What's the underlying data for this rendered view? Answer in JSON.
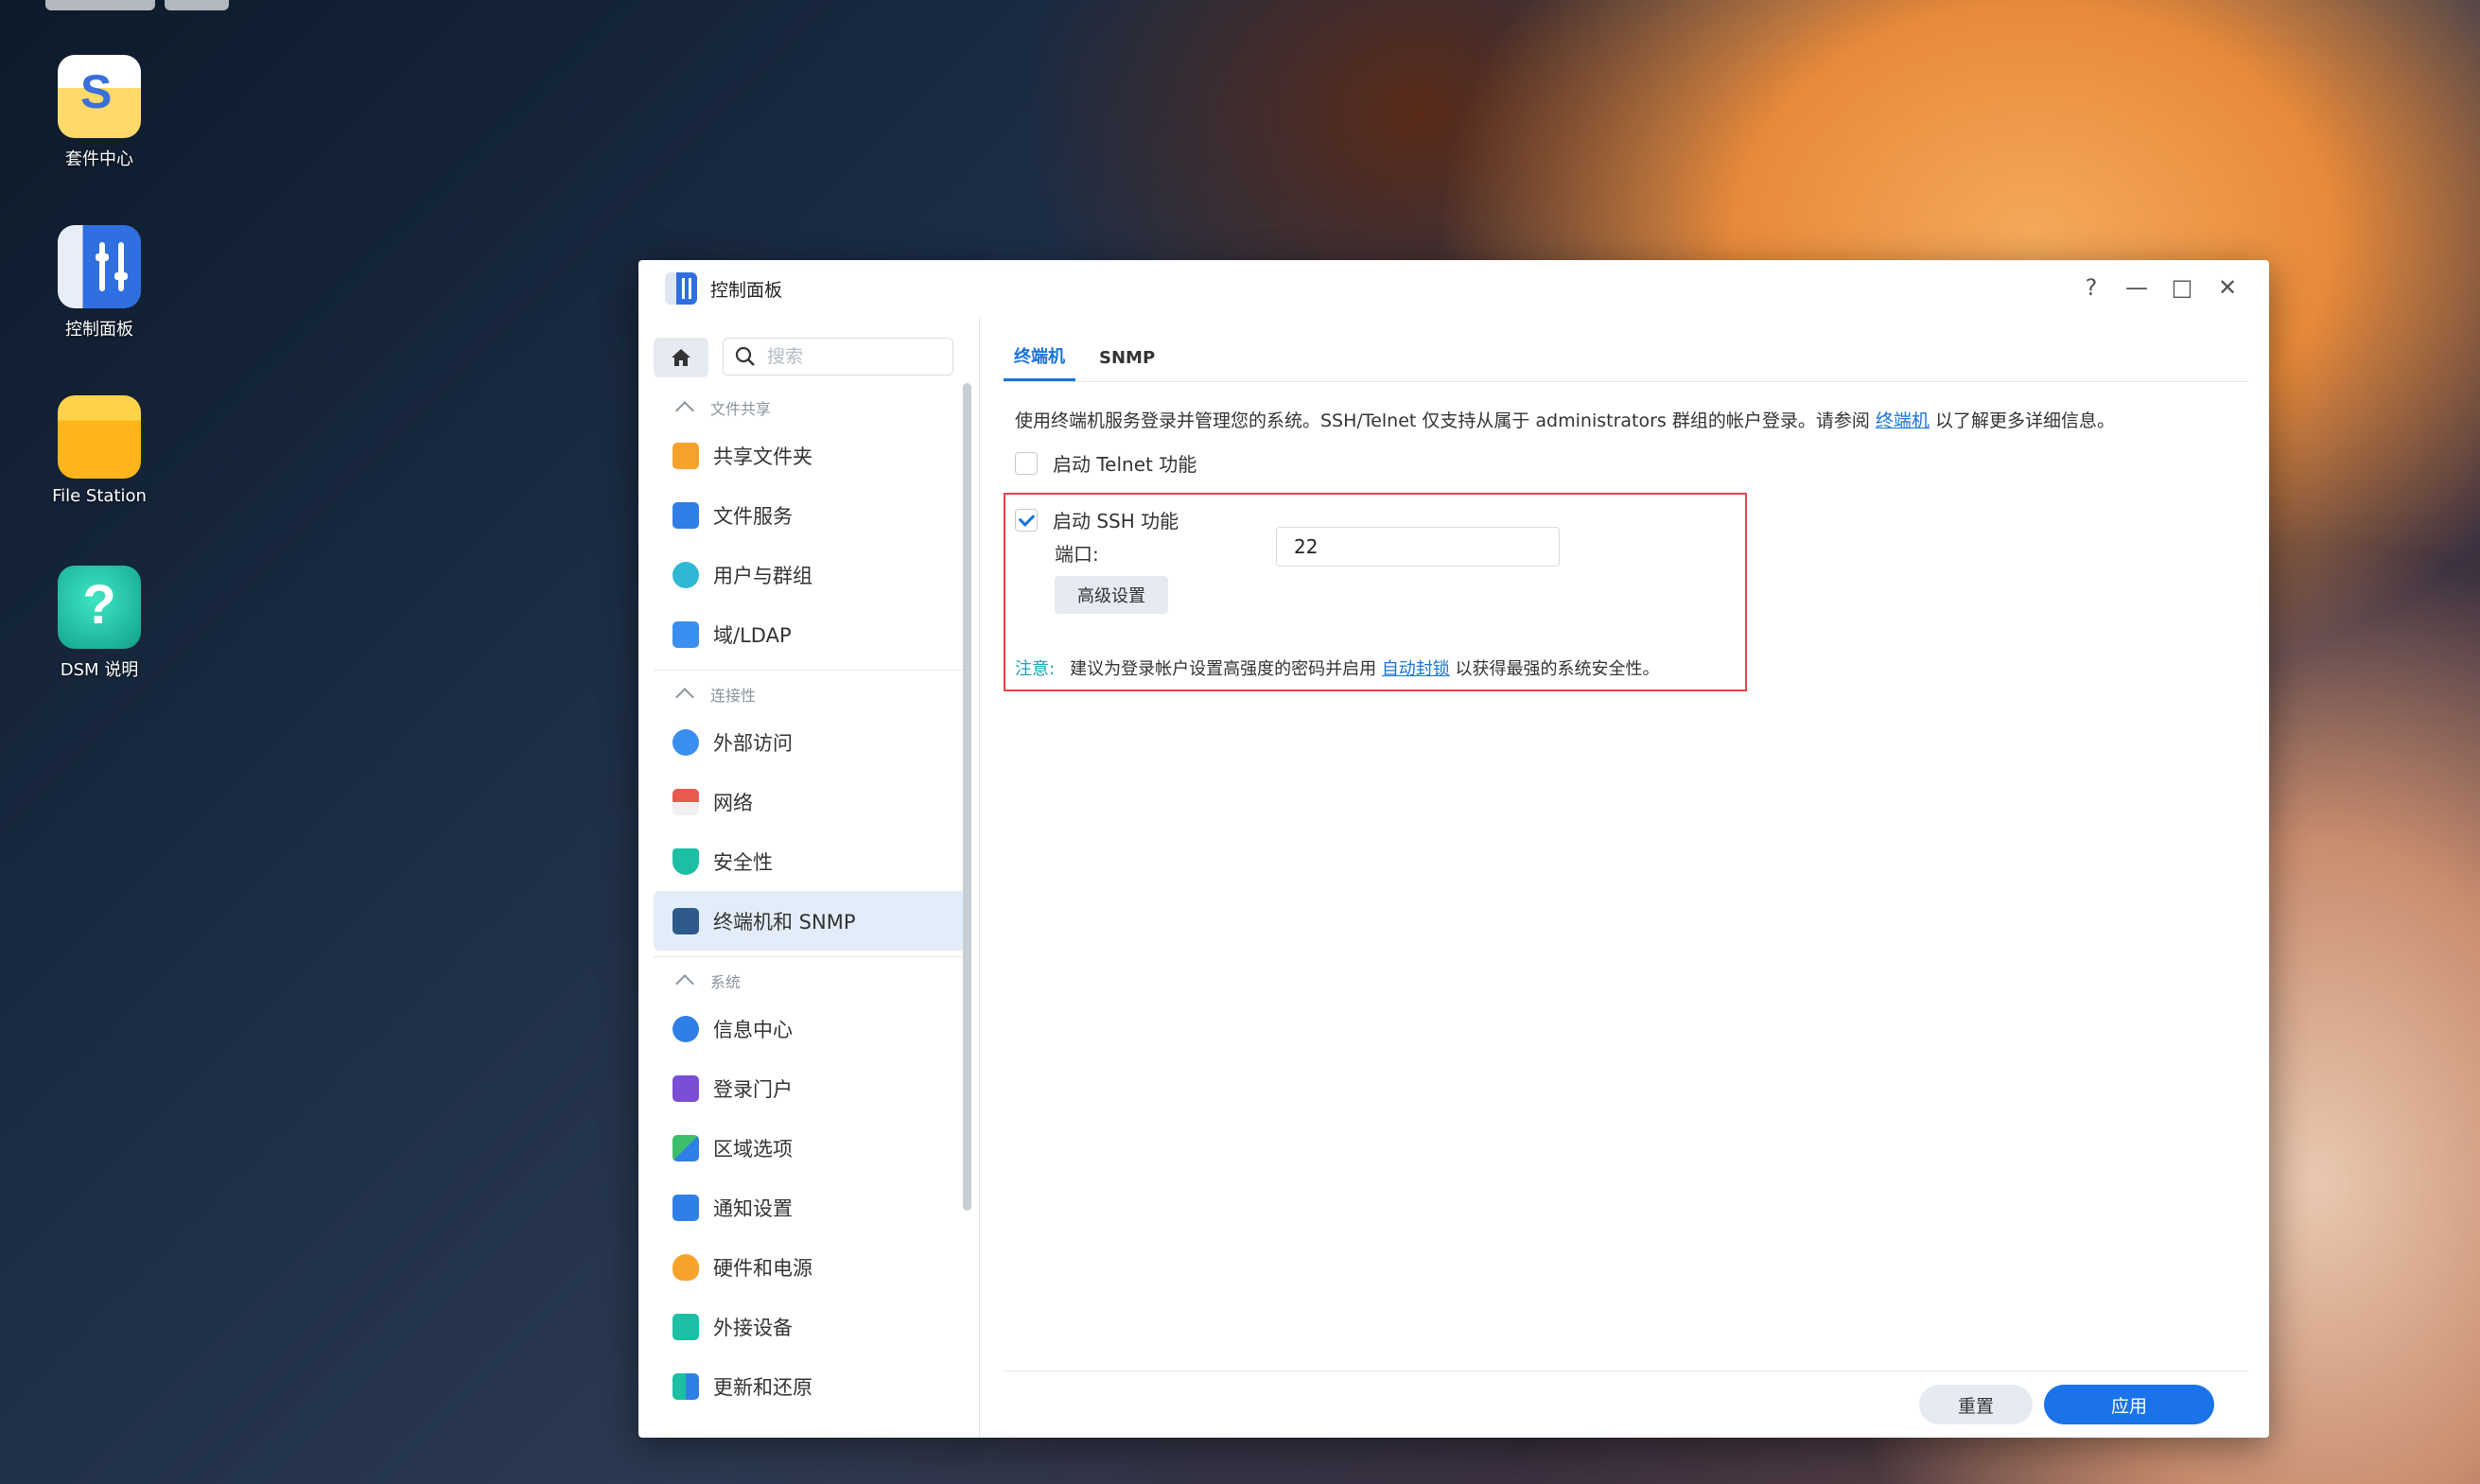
{
  "desktop": {
    "icons": [
      {
        "label": "套件中心"
      },
      {
        "label": "控制面板"
      },
      {
        "label": "File Station"
      },
      {
        "label": "DSM 说明"
      }
    ]
  },
  "window": {
    "title": "控制面板",
    "controls": {
      "help": "?",
      "minimize": "—",
      "maximize": "□",
      "close": "✕"
    }
  },
  "sidebar": {
    "search_placeholder": "搜索",
    "sections": [
      {
        "title": "文件共享",
        "items": [
          "共享文件夹",
          "文件服务",
          "用户与群组",
          "域/LDAP"
        ]
      },
      {
        "title": "连接性",
        "items": [
          "外部访问",
          "网络",
          "安全性",
          "终端机和 SNMP"
        ]
      },
      {
        "title": "系统",
        "items": [
          "信息中心",
          "登录门户",
          "区域选项",
          "通知设置",
          "硬件和电源",
          "外接设备",
          "更新和还原"
        ]
      }
    ],
    "active_item": "终端机和 SNMP"
  },
  "main": {
    "tabs": [
      "终端机",
      "SNMP"
    ],
    "active_tab": "终端机",
    "description_prefix": "使用终端机服务登录并管理您的系统。SSH/Telnet 仅支持从属于 administrators 群组的帐户登录。请参阅 ",
    "description_link": "终端机",
    "description_suffix": " 以了解更多详细信息。",
    "telnet_label": "启动 Telnet 功能",
    "telnet_checked": false,
    "ssh_label": "启动 SSH 功能",
    "ssh_checked": true,
    "port_label": "端口:",
    "port_value": "22",
    "advanced_button": "高级设置",
    "note_label": "注意:",
    "note_prefix": "建议为登录帐户设置高强度的密码并启用 ",
    "note_link": "自动封锁",
    "note_suffix": " 以获得最强的系统安全性。"
  },
  "footer": {
    "reset": "重置",
    "apply": "应用"
  },
  "colors": {
    "accent": "#1a73d9",
    "apply_button": "#1a73e8",
    "highlight_box": "#e8434b",
    "active_nav_bg": "#e3edf9"
  }
}
